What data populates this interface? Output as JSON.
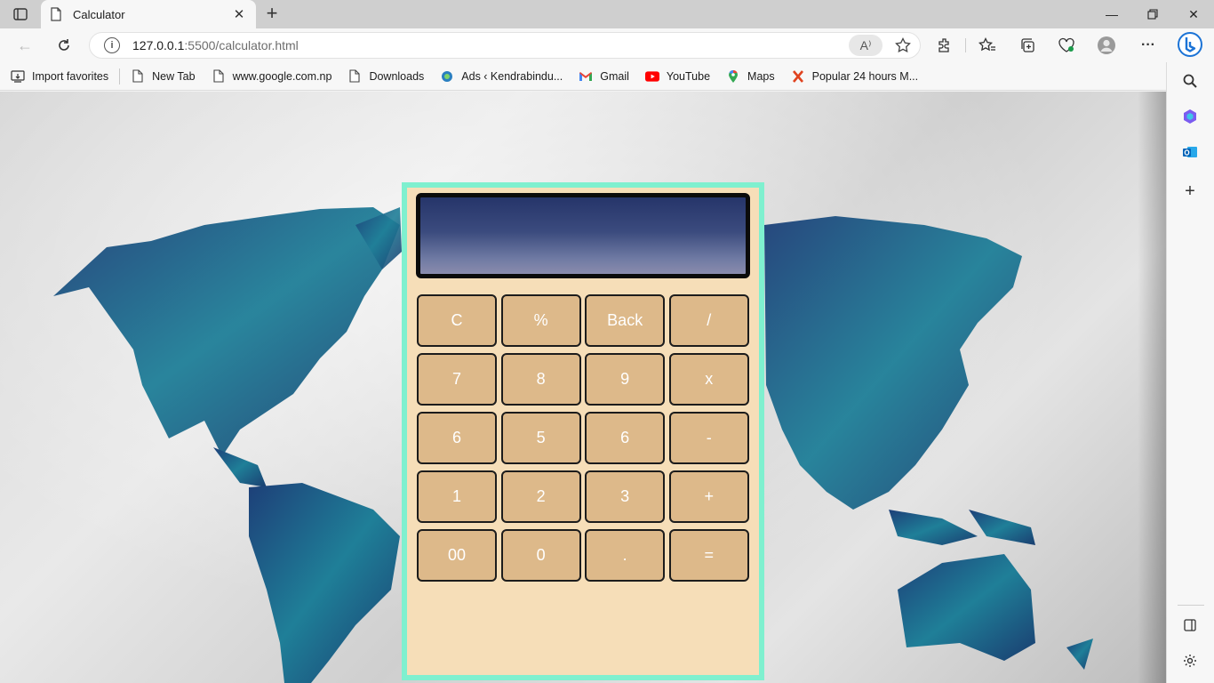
{
  "browser": {
    "tab_title": "Calculator",
    "address": {
      "host": "127.0.0.1",
      "rest": ":5500/calculator.html"
    },
    "read_aloud_label": "A⁾"
  },
  "bookmarks": [
    {
      "label": "Import favorites",
      "icon": "import-icon"
    },
    {
      "label": "New Tab",
      "icon": "page-icon"
    },
    {
      "label": "www.google.com.np",
      "icon": "page-icon"
    },
    {
      "label": "Downloads",
      "icon": "page-icon"
    },
    {
      "label": "Ads ‹ Kendrabindu...",
      "icon": "site-icon"
    },
    {
      "label": "Gmail",
      "icon": "gmail-icon"
    },
    {
      "label": "YouTube",
      "icon": "youtube-icon"
    },
    {
      "label": "Maps",
      "icon": "maps-icon"
    },
    {
      "label": "Popular 24 hours M...",
      "icon": "x-logo-icon"
    }
  ],
  "calculator": {
    "display_value": "",
    "keys": [
      [
        "C",
        "%",
        "Back",
        "/"
      ],
      [
        "7",
        "8",
        "9",
        "x"
      ],
      [
        "6",
        "5",
        "6",
        "-"
      ],
      [
        "1",
        "2",
        "3",
        "+"
      ],
      [
        "00",
        "0",
        ".",
        "="
      ]
    ]
  },
  "colors": {
    "calc_border": "#7ff0cf",
    "calc_body": "#f6deb8",
    "key_fill": "#ddb98a",
    "map_blue": "#1f6f8c"
  }
}
